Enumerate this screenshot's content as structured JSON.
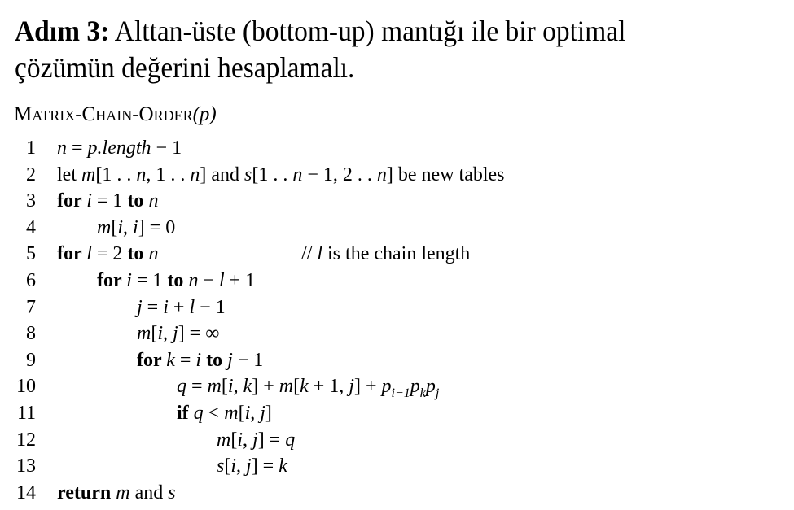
{
  "heading": {
    "step_label": "Adım 3:",
    "text_line1": " Alttan-üste (bottom-up) mantığı ile bir optimal",
    "text_line2": "çözümün değerini hesaplamalı."
  },
  "procedure": {
    "name": "Matrix-Chain-Order",
    "argument": "(p)",
    "lines": [
      {
        "num": "1",
        "indent": 0,
        "parts": [
          [
            "it",
            "n"
          ],
          [
            "t",
            " = "
          ],
          [
            "it",
            "p.length"
          ],
          [
            "t",
            " − 1"
          ]
        ]
      },
      {
        "num": "2",
        "indent": 0,
        "parts": [
          [
            "t",
            "let "
          ],
          [
            "it",
            "m"
          ],
          [
            "t",
            "[1 . . "
          ],
          [
            "it",
            "n"
          ],
          [
            "t",
            ", 1 . . "
          ],
          [
            "it",
            "n"
          ],
          [
            "t",
            "] and "
          ],
          [
            "it",
            "s"
          ],
          [
            "t",
            "[1 . . "
          ],
          [
            "it",
            "n"
          ],
          [
            "t",
            " − 1, 2 . . "
          ],
          [
            "it",
            "n"
          ],
          [
            "t",
            "] be new tables"
          ]
        ]
      },
      {
        "num": "3",
        "indent": 0,
        "parts": [
          [
            "kw",
            "for "
          ],
          [
            "it",
            "i"
          ],
          [
            "t",
            " = 1 "
          ],
          [
            "kw",
            "to "
          ],
          [
            "it",
            "n"
          ]
        ]
      },
      {
        "num": "4",
        "indent": 1,
        "parts": [
          [
            "it",
            "m"
          ],
          [
            "t",
            "["
          ],
          [
            "it",
            "i"
          ],
          [
            "t",
            ", "
          ],
          [
            "it",
            "i"
          ],
          [
            "t",
            "] = 0"
          ]
        ]
      },
      {
        "num": "5",
        "indent": 0,
        "parts": [
          [
            "kw",
            "for "
          ],
          [
            "it",
            "l"
          ],
          [
            "t",
            " = 2 "
          ],
          [
            "kw",
            "to "
          ],
          [
            "it",
            "n"
          ]
        ],
        "comment": [
          [
            "t",
            "// "
          ],
          [
            "it",
            "l"
          ],
          [
            "t",
            " is the chain length"
          ]
        ]
      },
      {
        "num": "6",
        "indent": 1,
        "parts": [
          [
            "kw",
            "for "
          ],
          [
            "it",
            "i"
          ],
          [
            "t",
            " = 1 "
          ],
          [
            "kw",
            "to "
          ],
          [
            "it",
            "n"
          ],
          [
            "t",
            " − "
          ],
          [
            "it",
            "l"
          ],
          [
            "t",
            " + 1"
          ]
        ]
      },
      {
        "num": "7",
        "indent": 2,
        "parts": [
          [
            "it",
            "j"
          ],
          [
            "t",
            " = "
          ],
          [
            "it",
            "i"
          ],
          [
            "t",
            " + "
          ],
          [
            "it",
            "l"
          ],
          [
            "t",
            " − 1"
          ]
        ]
      },
      {
        "num": "8",
        "indent": 2,
        "parts": [
          [
            "it",
            "m"
          ],
          [
            "t",
            "["
          ],
          [
            "it",
            "i"
          ],
          [
            "t",
            ", "
          ],
          [
            "it",
            "j"
          ],
          [
            "t",
            "] = ∞"
          ]
        ]
      },
      {
        "num": "9",
        "indent": 2,
        "parts": [
          [
            "kw",
            "for "
          ],
          [
            "it",
            "k"
          ],
          [
            "t",
            " = "
          ],
          [
            "it",
            "i"
          ],
          [
            "kw",
            " to "
          ],
          [
            "it",
            "j"
          ],
          [
            "t",
            " − 1"
          ]
        ]
      },
      {
        "num": "10",
        "indent": 3,
        "parts": [
          [
            "it",
            "q"
          ],
          [
            "t",
            " = "
          ],
          [
            "it",
            "m"
          ],
          [
            "t",
            "["
          ],
          [
            "it",
            "i"
          ],
          [
            "t",
            ", "
          ],
          [
            "it",
            "k"
          ],
          [
            "t",
            "] + "
          ],
          [
            "it",
            "m"
          ],
          [
            "t",
            "["
          ],
          [
            "it",
            "k"
          ],
          [
            "t",
            " + 1, "
          ],
          [
            "it",
            "j"
          ],
          [
            "t",
            "] + "
          ],
          [
            "it",
            "p"
          ],
          [
            "sub",
            "i−1"
          ],
          [
            "it",
            "p"
          ],
          [
            "sub",
            "k"
          ],
          [
            "it",
            "p"
          ],
          [
            "sub",
            "j"
          ]
        ]
      },
      {
        "num": "11",
        "indent": 3,
        "parts": [
          [
            "kw",
            "if "
          ],
          [
            "it",
            "q"
          ],
          [
            "t",
            " < "
          ],
          [
            "it",
            "m"
          ],
          [
            "t",
            "["
          ],
          [
            "it",
            "i"
          ],
          [
            "t",
            ", "
          ],
          [
            "it",
            "j"
          ],
          [
            "t",
            "]"
          ]
        ]
      },
      {
        "num": "12",
        "indent": 4,
        "parts": [
          [
            "it",
            "m"
          ],
          [
            "t",
            "["
          ],
          [
            "it",
            "i"
          ],
          [
            "t",
            ", "
          ],
          [
            "it",
            "j"
          ],
          [
            "t",
            "] = "
          ],
          [
            "it",
            "q"
          ]
        ]
      },
      {
        "num": "13",
        "indent": 4,
        "parts": [
          [
            "it",
            "s"
          ],
          [
            "t",
            "["
          ],
          [
            "it",
            "i"
          ],
          [
            "t",
            ", "
          ],
          [
            "it",
            "j"
          ],
          [
            "t",
            "] = "
          ],
          [
            "it",
            "k"
          ]
        ]
      },
      {
        "num": "14",
        "indent": 0,
        "parts": [
          [
            "kw",
            "return "
          ],
          [
            "it",
            "m"
          ],
          [
            "t",
            " and "
          ],
          [
            "it",
            "s"
          ]
        ]
      }
    ]
  }
}
